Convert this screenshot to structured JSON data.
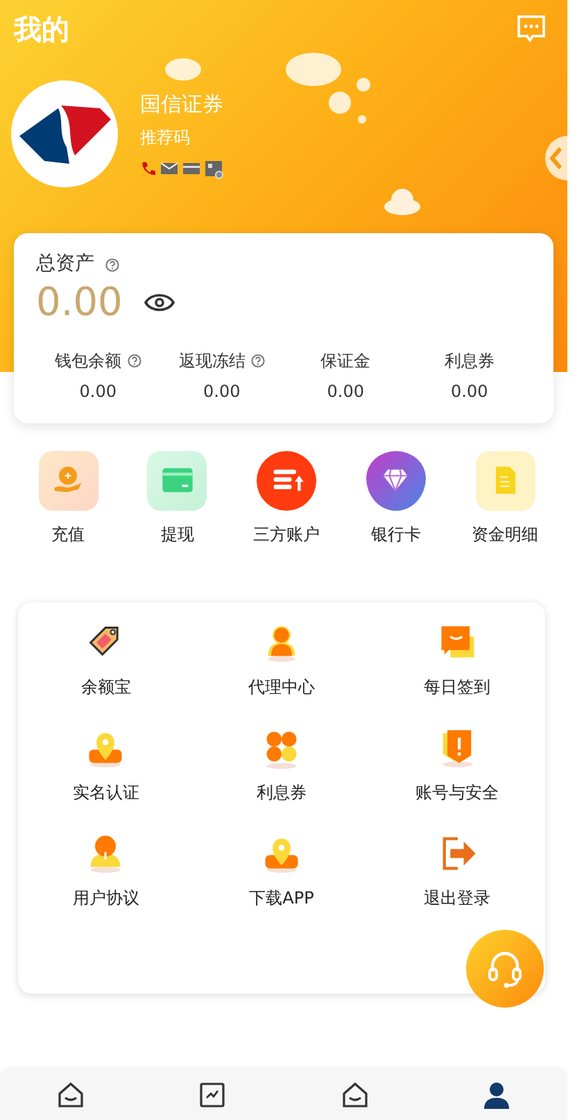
{
  "header": {
    "title": "我的"
  },
  "profile": {
    "name": "国信证券",
    "referral": "推荐码"
  },
  "assets": {
    "label": "总资产",
    "total": "0.00",
    "items": [
      {
        "label": "钱包余额",
        "value": "0.00",
        "help": true
      },
      {
        "label": "返现冻结",
        "value": "0.00",
        "help": true
      },
      {
        "label": "保证金",
        "value": "0.00",
        "help": false
      },
      {
        "label": "利息券",
        "value": "0.00",
        "help": false
      }
    ]
  },
  "quick_actions": [
    {
      "label": "充值",
      "kind": "recharge"
    },
    {
      "label": "提现",
      "kind": "withdraw"
    },
    {
      "label": "三方账户",
      "kind": "account"
    },
    {
      "label": "银行卡",
      "kind": "bank"
    },
    {
      "label": "资金明细",
      "kind": "detail"
    }
  ],
  "menu": [
    {
      "label": "余额宝",
      "kind": "tag"
    },
    {
      "label": "代理中心",
      "kind": "agent"
    },
    {
      "label": "每日签到",
      "kind": "signin"
    },
    {
      "label": "实名认证",
      "kind": "pin"
    },
    {
      "label": "利息券",
      "kind": "clover"
    },
    {
      "label": "账号与安全",
      "kind": "shield"
    },
    {
      "label": "用户协议",
      "kind": "user"
    },
    {
      "label": "下载APP",
      "kind": "pin"
    },
    {
      "label": "退出登录",
      "kind": "logout"
    }
  ],
  "bottom_nav": [
    {
      "kind": "home",
      "selected": false
    },
    {
      "kind": "chart",
      "selected": false
    },
    {
      "kind": "home",
      "selected": false
    },
    {
      "kind": "person",
      "selected": true
    }
  ]
}
